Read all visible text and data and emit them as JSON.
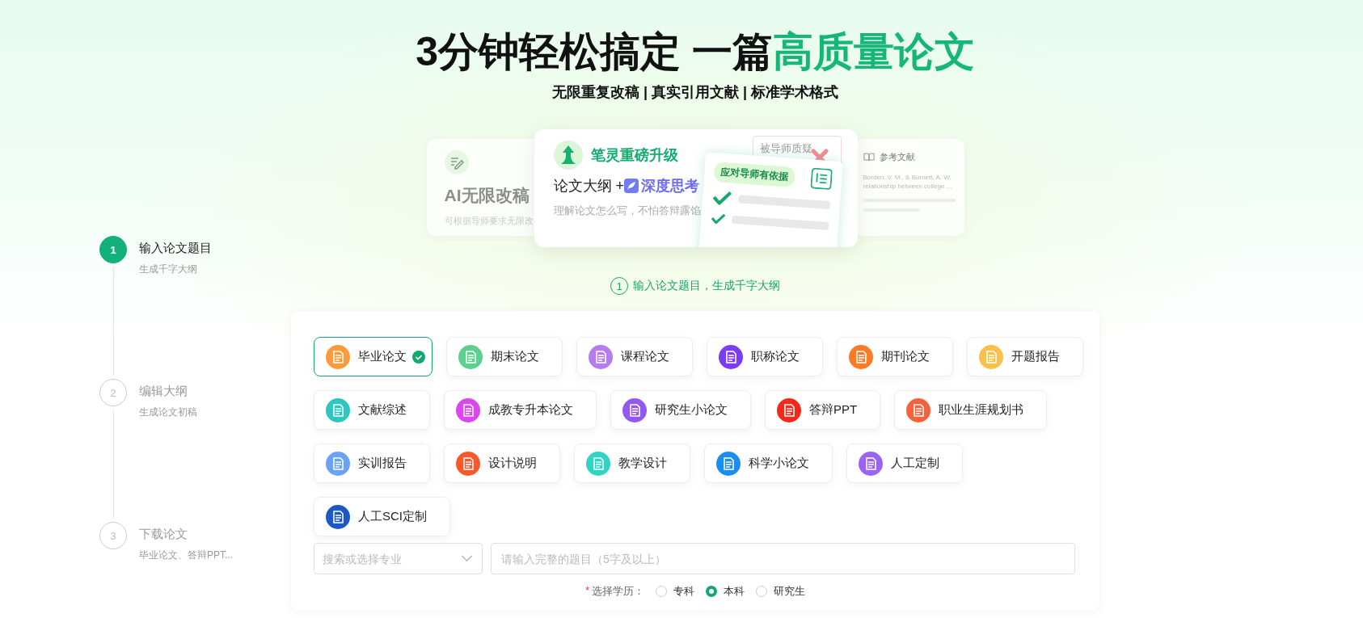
{
  "headline": {
    "lead": "3分钟轻松搞定 一篇",
    "highlight": "高质量论文"
  },
  "tagline": "无限重复改稿 | 真实引用文献 | 标准学术格式",
  "banner": {
    "left_card": {
      "title": "AI无限改稿",
      "subtitle": "可根据导师要求无限改"
    },
    "main_card": {
      "badge": "笔灵重磅升级",
      "line_lead": "论文大纲 + ",
      "line_highlight": "深度思考",
      "subtitle": "理解论文怎么写，不怕答辩露馅",
      "note": "被导师质疑",
      "paper_tag": "应对导师有依据"
    },
    "right_card": {
      "title": "参考文献",
      "lines": [
        "Borden, V. M., & Burnett, A. W.",
        "relationship between college ..."
      ]
    }
  },
  "steps": [
    {
      "number": "1",
      "title": "输入论文题目",
      "subtitle": "生成千字大纲",
      "selected": true
    },
    {
      "number": "2",
      "title": "编辑大纲",
      "subtitle": "生成论文初稿",
      "selected": false
    },
    {
      "number": "3",
      "title": "下载论文",
      "subtitle": "毕业论文、答辩PPT...",
      "selected": false
    }
  ],
  "step_caption": {
    "number": "1",
    "text": "输入论文题目，生成千字大纲"
  },
  "categories": [
    [
      {
        "label": "毕业论文",
        "color": "#fb9a3b",
        "selected": true
      },
      {
        "label": "期末论文",
        "color": "#5cd08f",
        "selected": false
      },
      {
        "label": "课程论文",
        "color": "#b57cf2",
        "selected": false
      },
      {
        "label": "职称论文",
        "color": "#7a3cf5",
        "selected": false
      },
      {
        "label": "期刊论文",
        "color": "#fb7a25",
        "selected": false
      },
      {
        "label": "开题报告",
        "color": "#fbc04a",
        "selected": false
      }
    ],
    [
      {
        "label": "文献综述",
        "color": "#2fc6bf",
        "selected": false
      },
      {
        "label": "成教专升本论文",
        "color": "#dd45ee",
        "selected": false
      },
      {
        "label": "研究生小论文",
        "color": "#9158f2",
        "selected": false
      },
      {
        "label": "答辩PPT",
        "color": "#f5281a",
        "selected": false
      },
      {
        "label": "职业生涯规划书",
        "color": "#f8613a",
        "selected": false
      }
    ],
    [
      {
        "label": "实训报告",
        "color": "#6aa2f7",
        "selected": false
      },
      {
        "label": "设计说明",
        "color": "#f9592a",
        "selected": false
      },
      {
        "label": "教学设计",
        "color": "#2fd4c5",
        "selected": false
      },
      {
        "label": "科学小论文",
        "color": "#1a8ef0",
        "selected": false
      },
      {
        "label": "人工定制",
        "color": "#9a63f6",
        "selected": false
      }
    ],
    [
      {
        "label": "人工SCI定制",
        "color": "#1d58c8",
        "selected": false
      }
    ]
  ],
  "major_select": {
    "placeholder": "搜索或选择专业"
  },
  "topic_input": {
    "placeholder": "请输入完整的题目（5字及以上）"
  },
  "education": {
    "required_mark": "*",
    "label": "选择学历：",
    "options": [
      {
        "label": "专科",
        "selected": false
      },
      {
        "label": "本科",
        "selected": true
      },
      {
        "label": "研究生",
        "selected": false
      }
    ]
  }
}
